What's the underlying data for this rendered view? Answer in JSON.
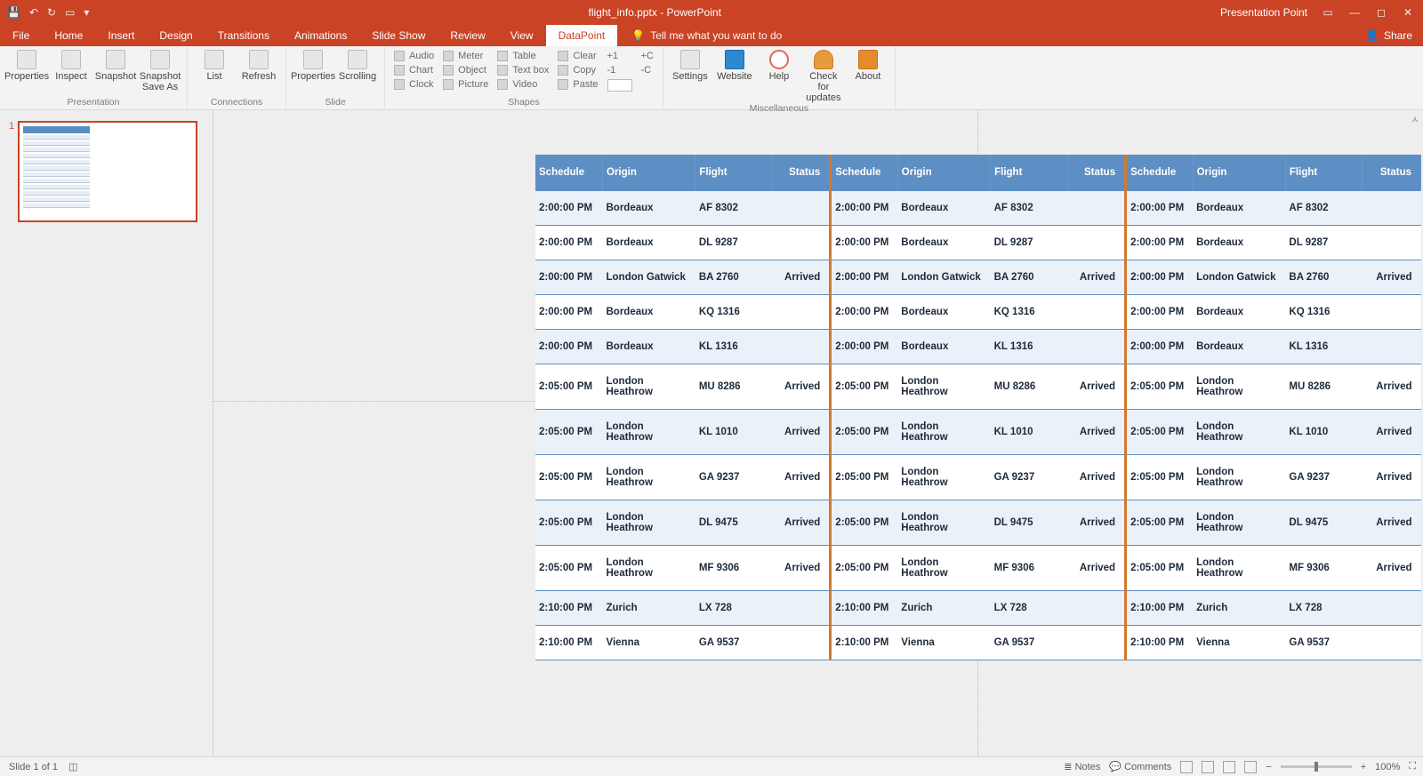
{
  "titlebar": {
    "document_title": "flight_info.pptx - PowerPoint",
    "account": "Presentation Point"
  },
  "tabs": {
    "items": [
      "File",
      "Home",
      "Insert",
      "Design",
      "Transitions",
      "Animations",
      "Slide Show",
      "Review",
      "View",
      "DataPoint"
    ],
    "active": "DataPoint",
    "tellme": "Tell me what you want to do",
    "share": "Share"
  },
  "ribbon": {
    "groups": {
      "presentation": {
        "label": "Presentation",
        "buttons": [
          "Properties",
          "Inspect",
          "Snapshot",
          "Snapshot Save As"
        ]
      },
      "connections": {
        "label": "Connections",
        "buttons": [
          "List",
          "Refresh"
        ]
      },
      "slide": {
        "label": "Slide",
        "buttons": [
          "Properties",
          "Scrolling"
        ]
      },
      "shapes": {
        "label": "Shapes",
        "col1": [
          "Audio",
          "Chart",
          "Clock"
        ],
        "col2": [
          "Meter",
          "Object",
          "Picture"
        ],
        "col3": [
          "Table",
          "Text box",
          "Video"
        ],
        "col4": [
          "Clear",
          "Copy",
          "Paste"
        ],
        "col5": [
          "+1",
          "-1",
          ""
        ],
        "col6": [
          "+C",
          "-C",
          ""
        ]
      },
      "misc": {
        "label": "Miscellaneous",
        "buttons": [
          "Settings",
          "Website",
          "Help",
          "Check for updates",
          "About"
        ]
      }
    }
  },
  "slide": {
    "headers": [
      "Schedule",
      "Origin",
      "Flight",
      "Status"
    ],
    "rows": [
      {
        "schedule": "2:00:00 PM",
        "origin": "Bordeaux",
        "flight": "AF 8302",
        "status": ""
      },
      {
        "schedule": "2:00:00 PM",
        "origin": "Bordeaux",
        "flight": "DL 9287",
        "status": ""
      },
      {
        "schedule": "2:00:00 PM",
        "origin": "London Gatwick",
        "flight": "BA 2760",
        "status": "Arrived"
      },
      {
        "schedule": "2:00:00 PM",
        "origin": "Bordeaux",
        "flight": "KQ 1316",
        "status": ""
      },
      {
        "schedule": "2:00:00 PM",
        "origin": "Bordeaux",
        "flight": "KL 1316",
        "status": ""
      },
      {
        "schedule": "2:05:00 PM",
        "origin": "London Heathrow",
        "flight": "MU 8286",
        "status": "Arrived"
      },
      {
        "schedule": "2:05:00 PM",
        "origin": "London Heathrow",
        "flight": "KL 1010",
        "status": "Arrived"
      },
      {
        "schedule": "2:05:00 PM",
        "origin": "London Heathrow",
        "flight": "GA 9237",
        "status": "Arrived"
      },
      {
        "schedule": "2:05:00 PM",
        "origin": "London Heathrow",
        "flight": "DL 9475",
        "status": "Arrived"
      },
      {
        "schedule": "2:05:00 PM",
        "origin": "London Heathrow",
        "flight": "MF 9306",
        "status": "Arrived"
      },
      {
        "schedule": "2:10:00 PM",
        "origin": "Zurich",
        "flight": "LX 728",
        "status": ""
      },
      {
        "schedule": "2:10:00 PM",
        "origin": "Vienna",
        "flight": "GA 9537",
        "status": ""
      }
    ]
  },
  "thumb": {
    "number": "1"
  },
  "statusbar": {
    "slide_indicator": "Slide 1 of 1",
    "notes": "Notes",
    "comments": "Comments",
    "zoom": "100%"
  }
}
